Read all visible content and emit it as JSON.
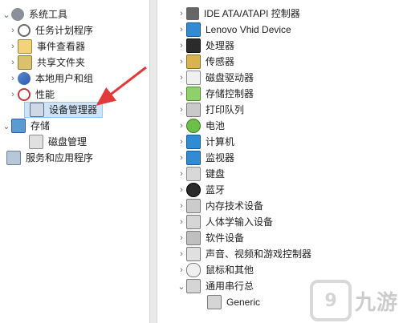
{
  "left_tree": {
    "items": [
      {
        "label": "系统工具",
        "expanded": true
      },
      {
        "label": "任务计划程序"
      },
      {
        "label": "事件查看器"
      },
      {
        "label": "共享文件夹"
      },
      {
        "label": "本地用户和组"
      },
      {
        "label": "性能"
      },
      {
        "label": "设备管理器",
        "selected": true
      },
      {
        "label": "存储",
        "expanded": true
      },
      {
        "label": "磁盘管理"
      },
      {
        "label": "服务和应用程序"
      }
    ]
  },
  "right_tree": {
    "items": [
      {
        "label": "IDE ATA/ATAPI 控制器"
      },
      {
        "label": "Lenovo Vhid Device"
      },
      {
        "label": "处理器"
      },
      {
        "label": "传感器"
      },
      {
        "label": "磁盘驱动器"
      },
      {
        "label": "存储控制器"
      },
      {
        "label": "打印队列"
      },
      {
        "label": "电池"
      },
      {
        "label": "计算机"
      },
      {
        "label": "监视器"
      },
      {
        "label": "键盘"
      },
      {
        "label": "蓝牙"
      },
      {
        "label": "内存技术设备"
      },
      {
        "label": "人体学输入设备"
      },
      {
        "label": "软件设备"
      },
      {
        "label": "声音、视频和游戏控制器"
      },
      {
        "label": "鼠标和其他"
      },
      {
        "label": "通用串行总"
      },
      {
        "label": "Generic"
      }
    ]
  },
  "glyphs": {
    "chevron_right": "›",
    "chevron_down": "⌄"
  },
  "colors": {
    "arrow": "#e23a3a",
    "selection_bg": "#cfe3f7",
    "selection_border": "#9cc6ee"
  },
  "watermark": {
    "mark": "9",
    "text": "九游"
  }
}
